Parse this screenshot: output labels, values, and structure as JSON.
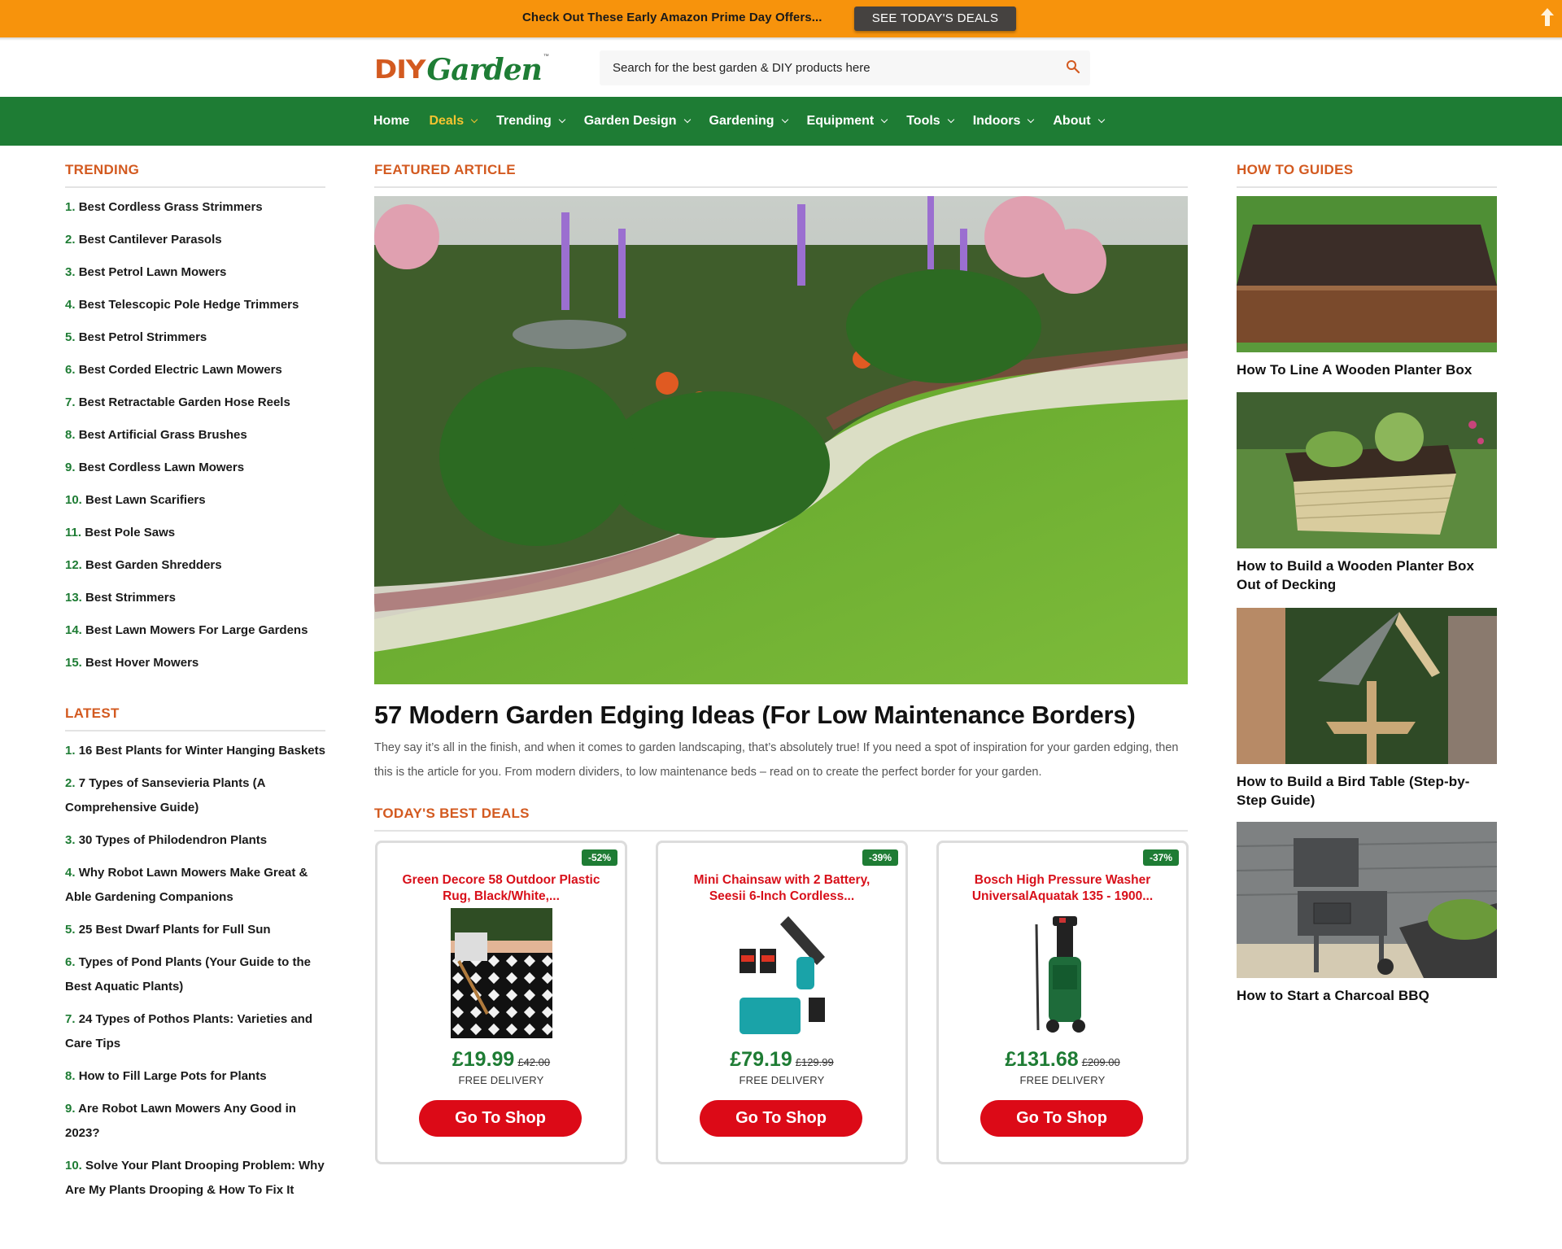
{
  "promo": {
    "text": "Check Out These Early Amazon Prime Day Offers...",
    "button_label": "SEE TODAY'S DEALS",
    "background": "#f7930c"
  },
  "header": {
    "logo_diy": "DIY",
    "logo_garden": "Garden",
    "logo_tm": "™",
    "search_placeholder": "Search for the best garden & DIY products here",
    "search_value": ""
  },
  "nav": {
    "items": [
      {
        "label": "Home",
        "has_dropdown": false,
        "active": false
      },
      {
        "label": "Deals",
        "has_dropdown": true,
        "active": true
      },
      {
        "label": "Trending",
        "has_dropdown": true,
        "active": false
      },
      {
        "label": "Garden Design",
        "has_dropdown": true,
        "active": false
      },
      {
        "label": "Gardening",
        "has_dropdown": true,
        "active": false
      },
      {
        "label": "Equipment",
        "has_dropdown": true,
        "active": false
      },
      {
        "label": "Tools",
        "has_dropdown": true,
        "active": false
      },
      {
        "label": "Indoors",
        "has_dropdown": true,
        "active": false
      },
      {
        "label": "About",
        "has_dropdown": true,
        "active": false
      }
    ]
  },
  "trending": {
    "title": "TRENDING",
    "items": [
      {
        "num": "1.",
        "label": "Best Cordless Grass Strimmers"
      },
      {
        "num": "2.",
        "label": "Best Cantilever Parasols"
      },
      {
        "num": "3.",
        "label": "Best Petrol Lawn Mowers"
      },
      {
        "num": "4.",
        "label": "Best Telescopic Pole Hedge Trimmers"
      },
      {
        "num": "5.",
        "label": "Best Petrol Strimmers"
      },
      {
        "num": "6.",
        "label": "Best Corded Electric Lawn Mowers"
      },
      {
        "num": "7.",
        "label": "Best Retractable Garden Hose Reels"
      },
      {
        "num": "8.",
        "label": "Best Artificial Grass Brushes"
      },
      {
        "num": "9.",
        "label": "Best Cordless Lawn Mowers"
      },
      {
        "num": "10.",
        "label": "Best Lawn Scarifiers"
      },
      {
        "num": "11.",
        "label": "Best Pole Saws"
      },
      {
        "num": "12.",
        "label": "Best Garden Shredders"
      },
      {
        "num": "13.",
        "label": "Best Strimmers"
      },
      {
        "num": "14.",
        "label": "Best Lawn Mowers For Large Gardens"
      },
      {
        "num": "15.",
        "label": "Best Hover Mowers"
      }
    ]
  },
  "latest": {
    "title": "LATEST",
    "items": [
      {
        "num": "1.",
        "label": "16 Best Plants for Winter Hanging Baskets"
      },
      {
        "num": "2.",
        "label": "7 Types of Sansevieria Plants (A Comprehensive Guide)"
      },
      {
        "num": "3.",
        "label": "30 Types of Philodendron Plants"
      },
      {
        "num": "4.",
        "label": "Why Robot Lawn Mowers Make Great & Able Gardening Companions"
      },
      {
        "num": "5.",
        "label": "25 Best Dwarf Plants for Full Sun"
      },
      {
        "num": "6.",
        "label": "Types of Pond Plants (Your Guide to the Best Aquatic Plants)"
      },
      {
        "num": "7.",
        "label": "24 Types of Pothos Plants: Varieties and Care Tips"
      },
      {
        "num": "8.",
        "label": "How to Fill Large Pots for Plants"
      },
      {
        "num": "9.",
        "label": "Are Robot Lawn Mowers Any Good in 2023?"
      },
      {
        "num": "10.",
        "label": "Solve Your Plant Drooping Problem: Why Are My Plants Drooping & How To Fix It"
      }
    ]
  },
  "featured": {
    "section_title": "FEATURED ARTICLE",
    "image_alt": "Curved garden border with flowers and lawn",
    "title": "57 Modern Garden Edging Ideas (For Low Maintenance Borders)",
    "description": "They say it’s all in the finish, and when it comes to garden landscaping, that’s absolutely true! If you need a spot of inspiration for your garden edging, then this is the article for you. From modern dividers, to low maintenance beds – read on to create the perfect border for your garden."
  },
  "deals": {
    "section_title": "TODAY'S BEST DEALS",
    "items": [
      {
        "badge": "-52%",
        "name": "Green Decore 58 Outdoor Plastic Rug, Black/White,...",
        "price": "£19.99",
        "was": "£42.00",
        "delivery": "FREE DELIVERY",
        "button": "Go To Shop"
      },
      {
        "badge": "-39%",
        "name": "Mini Chainsaw with 2 Battery, Seesii 6-Inch Cordless...",
        "price": "£79.19",
        "was": "£129.99",
        "delivery": "FREE DELIVERY",
        "button": "Go To Shop"
      },
      {
        "badge": "-37%",
        "name": "Bosch High Pressure Washer UniversalAquatak 135 - 1900...",
        "price": "£131.68",
        "was": "£209.00",
        "delivery": "FREE DELIVERY",
        "button": "Go To Shop"
      }
    ]
  },
  "guides": {
    "section_title": "HOW TO GUIDES",
    "items": [
      {
        "title": "How To Line A Wooden Planter Box"
      },
      {
        "title": "How to Build a Wooden Planter Box Out of Decking"
      },
      {
        "title": "How to Build a Bird Table (Step-by-Step Guide)"
      },
      {
        "title": "How to Start a Charcoal BBQ"
      }
    ]
  },
  "colors": {
    "brand_green": "#1e7c34",
    "accent_orange": "#d35a20",
    "deal_red": "#dc0a17",
    "nav_active": "#f4c430"
  }
}
